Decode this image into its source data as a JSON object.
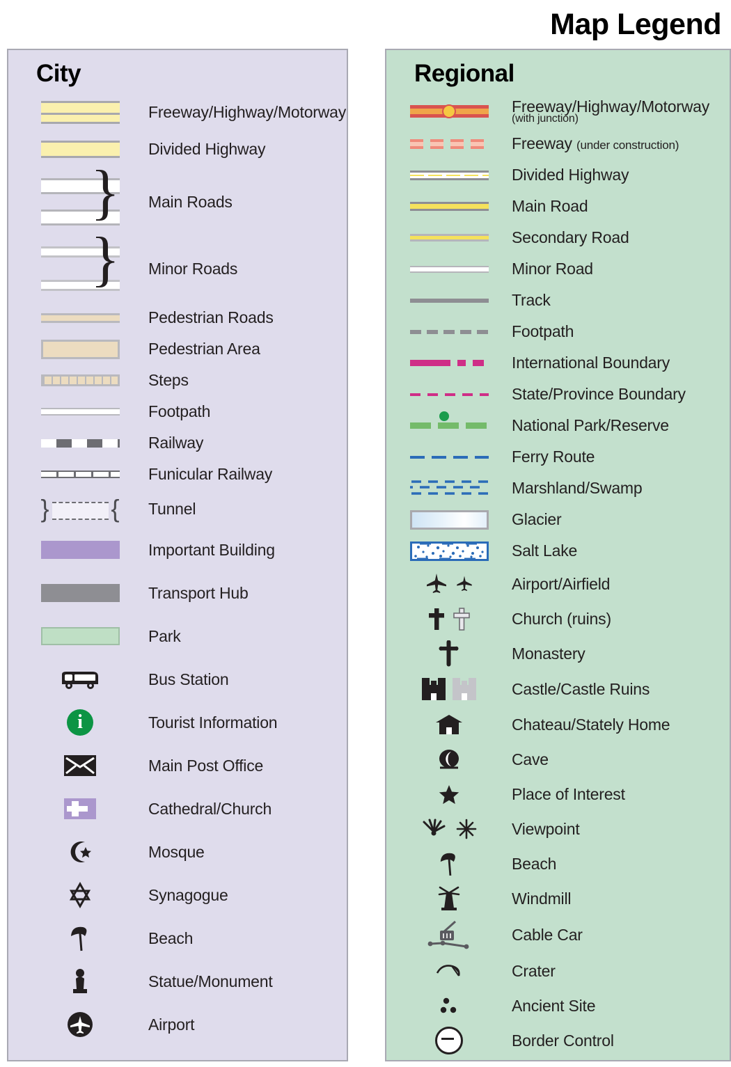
{
  "title": "Map Legend",
  "city": {
    "heading": "City",
    "bg_color": "#dfdcec",
    "items": [
      {
        "symbol": "freeway-double-band",
        "label": "Freeway/Highway/Motorway"
      },
      {
        "symbol": "divided-highway-band",
        "label": "Divided Highway"
      },
      {
        "symbol": "white-road-pair-brace",
        "label": "Main Roads"
      },
      {
        "symbol": "white-thin-road-pair-brace",
        "label": "Minor Roads"
      },
      {
        "symbol": "pedestrian-road-band",
        "label": "Pedestrian Roads"
      },
      {
        "symbol": "pedestrian-area-block",
        "label": "Pedestrian Area"
      },
      {
        "symbol": "steps-hatched-band",
        "label": "Steps"
      },
      {
        "symbol": "footpath-thin-line",
        "label": "Footpath"
      },
      {
        "symbol": "railway-dashed-band",
        "label": "Railway"
      },
      {
        "symbol": "funicular-ticked-line",
        "label": "Funicular Railway"
      },
      {
        "symbol": "tunnel-bracketed-dashes",
        "label": "Tunnel"
      },
      {
        "symbol": "important-building-swatch",
        "label": "Important Building"
      },
      {
        "symbol": "transport-hub-swatch",
        "label": "Transport Hub"
      },
      {
        "symbol": "park-swatch",
        "label": "Park"
      },
      {
        "symbol": "bus-icon",
        "label": "Bus Station"
      },
      {
        "symbol": "information-icon",
        "label": "Tourist Information"
      },
      {
        "symbol": "envelope-icon",
        "label": "Main Post Office"
      },
      {
        "symbol": "cathedral-cross-icon",
        "label": "Cathedral/Church"
      },
      {
        "symbol": "crescent-star-icon",
        "label": "Mosque"
      },
      {
        "symbol": "star-of-david-icon",
        "label": "Synagogue"
      },
      {
        "symbol": "beach-umbrella-icon",
        "label": "Beach"
      },
      {
        "symbol": "statue-icon",
        "label": "Statue/Monument"
      },
      {
        "symbol": "airport-circle-icon",
        "label": "Airport"
      }
    ]
  },
  "regional": {
    "heading": "Regional",
    "bg_color": "#c3e0cd",
    "items": [
      {
        "symbol": "freeway-junction-line",
        "label": "Freeway/Highway/Motorway",
        "sublabel": "(with junction)",
        "sub_style": "below"
      },
      {
        "symbol": "freeway-construction-dashes",
        "label": "Freeway",
        "sublabel": "(under construction)",
        "sub_style": "inline"
      },
      {
        "symbol": "divided-highway-line",
        "label": "Divided Highway"
      },
      {
        "symbol": "main-road-line",
        "label": "Main Road"
      },
      {
        "symbol": "secondary-road-line",
        "label": "Secondary Road"
      },
      {
        "symbol": "minor-road-line",
        "label": "Minor Road"
      },
      {
        "symbol": "track-line",
        "label": "Track"
      },
      {
        "symbol": "footpath-dashed-line",
        "label": "Footpath"
      },
      {
        "symbol": "international-boundary-line",
        "label": "International Boundary"
      },
      {
        "symbol": "state-boundary-dashed-line",
        "label": "State/Province Boundary"
      },
      {
        "symbol": "national-park-line",
        "label": "National Park/Reserve"
      },
      {
        "symbol": "ferry-route-dashed-line",
        "label": "Ferry Route"
      },
      {
        "symbol": "marshland-pattern",
        "label": "Marshland/Swamp"
      },
      {
        "symbol": "glacier-swatch",
        "label": "Glacier"
      },
      {
        "symbol": "salt-lake-swatch",
        "label": "Salt Lake"
      },
      {
        "symbol": "airplane-icons",
        "label": "Airport/Airfield"
      },
      {
        "symbol": "cross-icons",
        "label": "Church (ruins)"
      },
      {
        "symbol": "monastery-cross-icon",
        "label": "Monastery"
      },
      {
        "symbol": "castle-icons",
        "label": "Castle/Castle Ruins"
      },
      {
        "symbol": "chateau-icon",
        "label": "Chateau/Stately Home"
      },
      {
        "symbol": "cave-icon",
        "label": "Cave"
      },
      {
        "symbol": "star-icon",
        "label": "Place of Interest"
      },
      {
        "symbol": "viewpoint-icons",
        "label": "Viewpoint"
      },
      {
        "symbol": "beach-umbrella-icon",
        "label": "Beach"
      },
      {
        "symbol": "windmill-icon",
        "label": "Windmill"
      },
      {
        "symbol": "cable-car-icon",
        "label": "Cable Car"
      },
      {
        "symbol": "crater-icon",
        "label": "Crater"
      },
      {
        "symbol": "ancient-site-icon",
        "label": "Ancient Site"
      },
      {
        "symbol": "border-control-icon",
        "label": "Border Control"
      }
    ]
  },
  "colors": {
    "city_panel": "#dfdcec",
    "regional_panel": "#c3e0cd",
    "highway_yellow": "#faf0ae",
    "regional_yellow": "#f5e25c",
    "freeway_red": "#d9534f",
    "freeway_orange": "#f0a44a",
    "junction_yellow": "#f5c842",
    "pedestrian_tan": "#ecdcc0",
    "important_building_purple": "#ab97cd",
    "transport_grey": "#8e8e93",
    "park_green": "#bfdfc5",
    "boundary_magenta": "#cf2e87",
    "park_line_green": "#74bb6a",
    "ferry_blue": "#2b6cb8",
    "info_green": "#0c9444",
    "text": "#231f20"
  }
}
